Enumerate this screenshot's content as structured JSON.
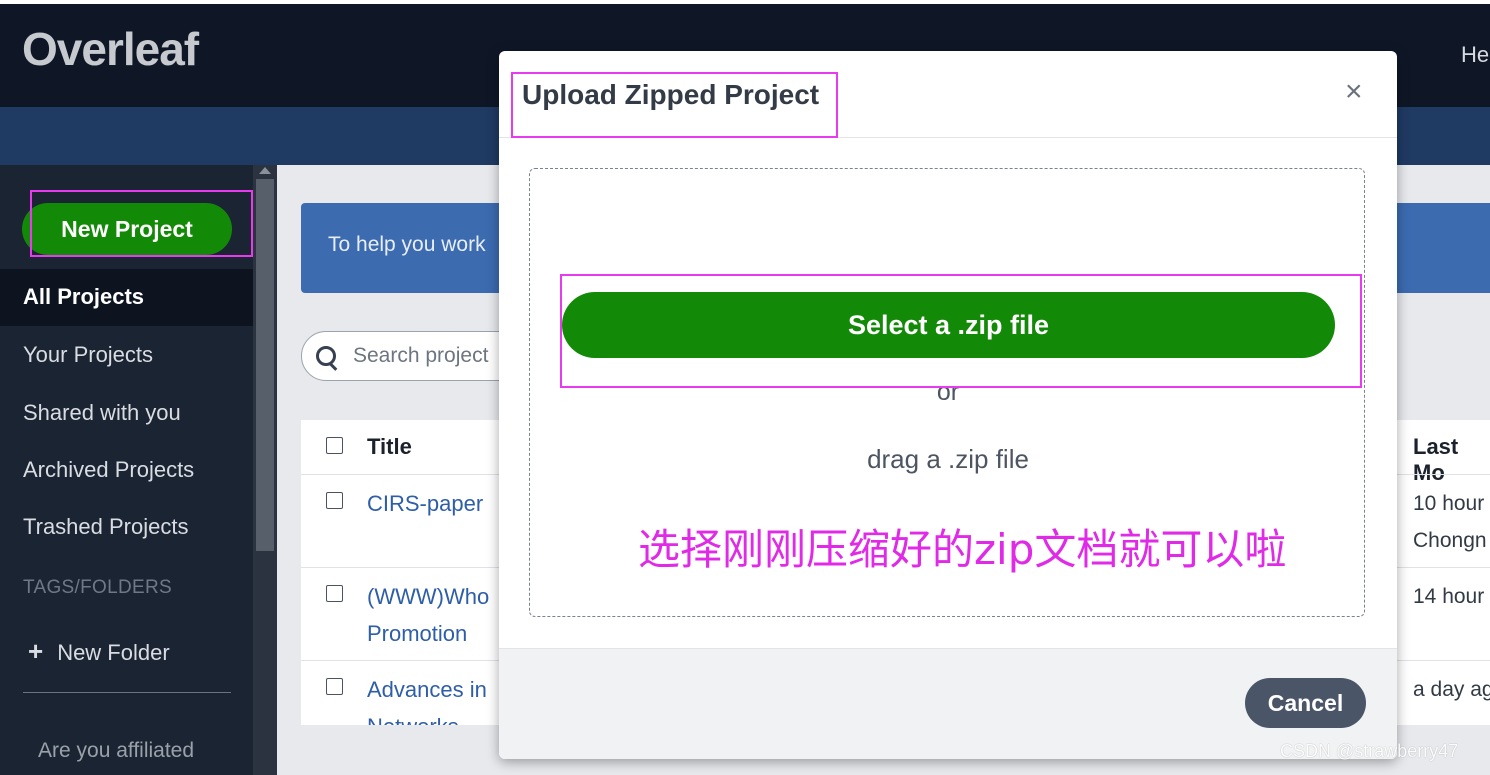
{
  "app": {
    "logo_text": "Overleaf",
    "nav_help_partial": "He"
  },
  "sidebar": {
    "new_project_label": "New Project",
    "items": [
      {
        "label": "All Projects",
        "active": true
      },
      {
        "label": "Your Projects"
      },
      {
        "label": "Shared with you"
      },
      {
        "label": "Archived Projects"
      },
      {
        "label": "Trashed Projects"
      }
    ],
    "tags_heading": "TAGS/FOLDERS",
    "new_folder_label": "New Folder",
    "affiliation_text": "Are you affiliated"
  },
  "main": {
    "notice_text": "To help you work",
    "search_placeholder": "Search project",
    "table": {
      "col_title": "Title",
      "col_last_modified": "Last Mo",
      "rows": [
        {
          "title": "CIRS-paper",
          "last_modified_line1": "10 hour",
          "last_modified_line2": "Chongn"
        },
        {
          "title": "(WWW)Who",
          "title_line2": "Promotion",
          "last_modified_line1": "14 hour"
        },
        {
          "title": "Advances in",
          "title_line2": "Networks",
          "last_modified_line1": "a day ag"
        }
      ]
    }
  },
  "modal": {
    "title": "Upload Zipped Project",
    "close_symbol": "×",
    "select_button_label": "Select a .zip file",
    "or_text": "or",
    "drag_text": "drag a .zip file",
    "annotation": "选择刚刚压缩好的zip文档就可以啦",
    "cancel_label": "Cancel"
  },
  "watermark": "CSDN @strawberry47",
  "colors": {
    "navbar": "#0f1727",
    "banner": "#1f3a63",
    "sidebar": "#1b2432",
    "brand_green": "#138a07",
    "highlight": "#e83bf0",
    "cancel_bg": "#4a5568"
  }
}
